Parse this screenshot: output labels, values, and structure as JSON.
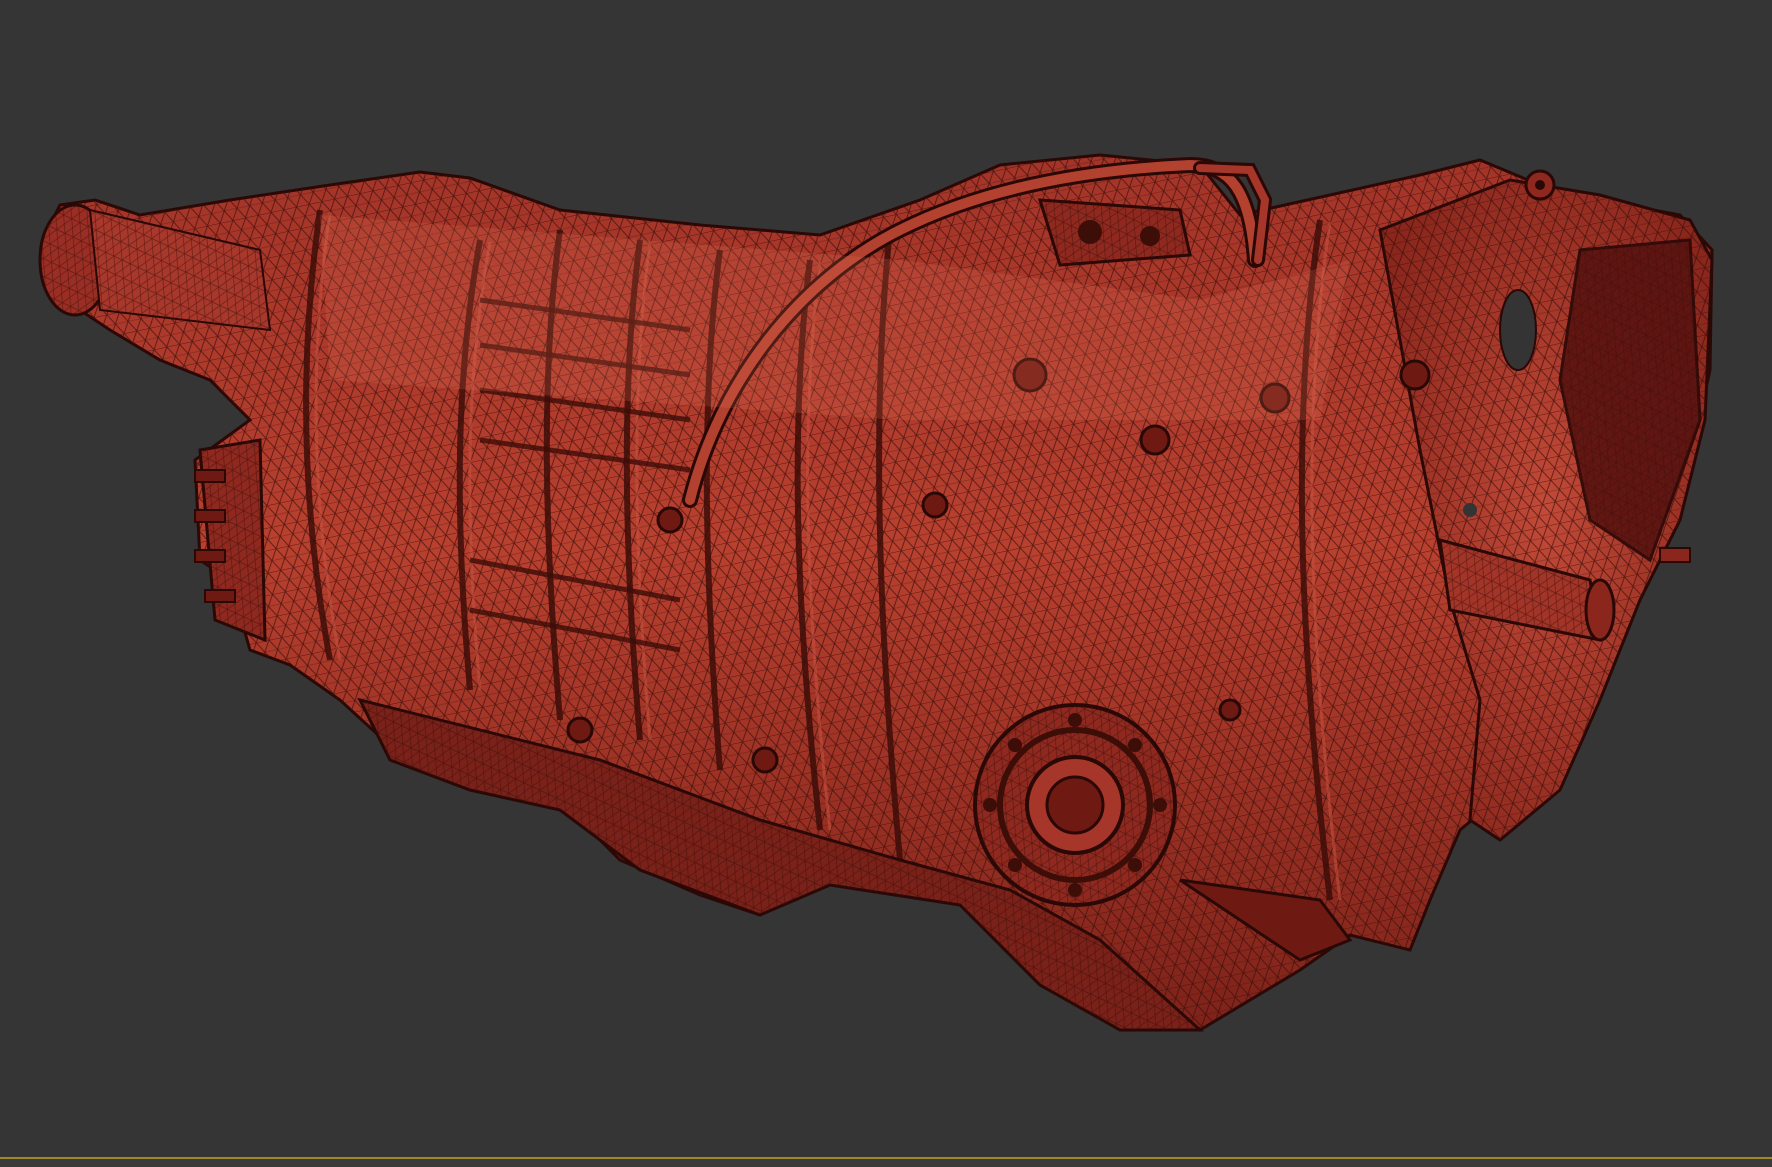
{
  "viewport": {
    "background_color": "#353535",
    "model_color": "#a8362b",
    "wire_color": "#3a0d09",
    "highlight_color": "#c9523f",
    "shadow_color": "#5e1510"
  },
  "status_bar": {
    "accent_color": "#9a8a2a"
  }
}
